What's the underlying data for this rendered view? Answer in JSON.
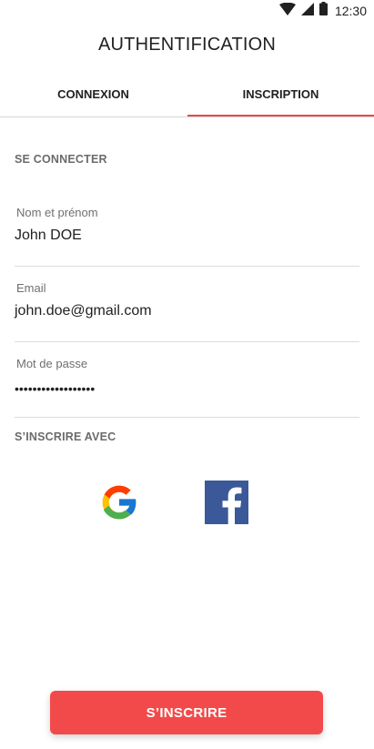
{
  "status_bar": {
    "time": "12:30",
    "icons": [
      "wifi-icon",
      "cellular-signal-icon",
      "battery-icon"
    ]
  },
  "app": {
    "title": "AUTHENTIFICATION"
  },
  "tabs": [
    {
      "label": "CONNEXION",
      "active": false
    },
    {
      "label": "INSCRIPTION",
      "active": true
    }
  ],
  "form": {
    "section_title": "SE CONNECTER",
    "fields": [
      {
        "label": "Nom et prénom",
        "value": "John DOE"
      },
      {
        "label": "Email",
        "value": "john.doe@gmail.com"
      },
      {
        "label": "Mot de passe",
        "value": "••••••••••••••••••"
      }
    ]
  },
  "social": {
    "section_title": "S’INSCRIRE AVEC",
    "providers": [
      "google-icon",
      "facebook-icon"
    ]
  },
  "submit": {
    "label": "S’INSCRIRE"
  },
  "colors": {
    "accent": "#e84a4a",
    "button": "#f24a4a",
    "facebook": "#3b5998"
  }
}
